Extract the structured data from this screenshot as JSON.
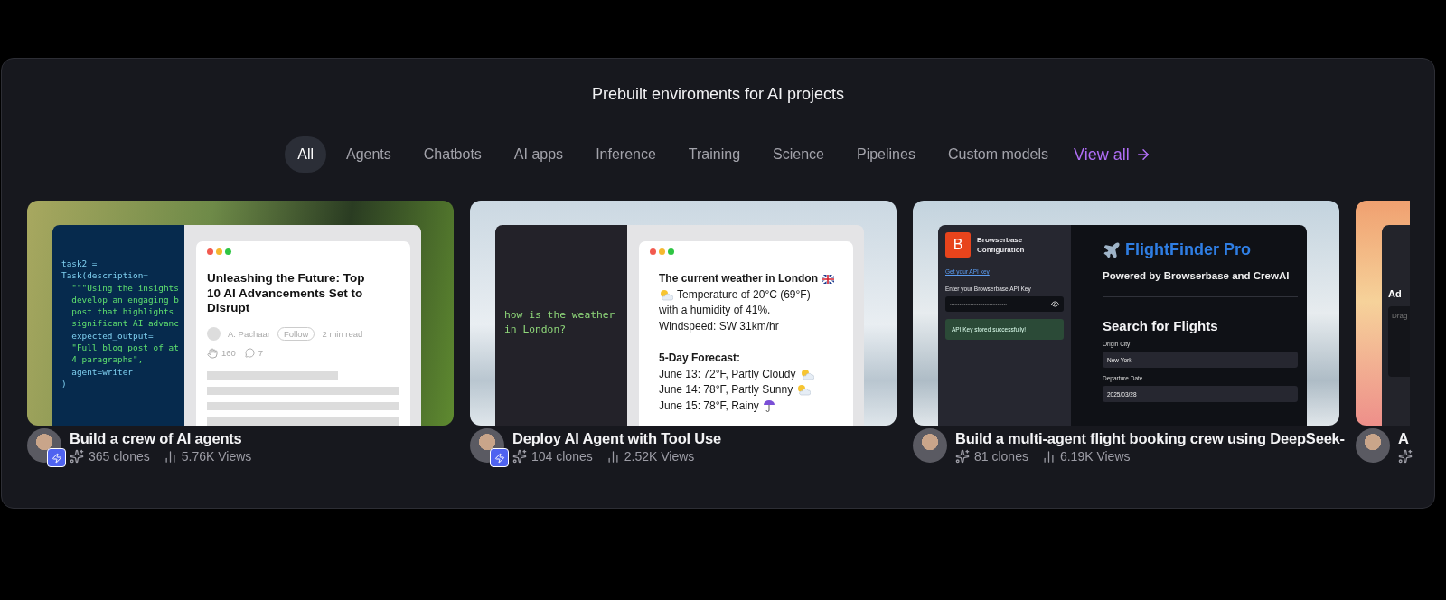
{
  "heading": "Prebuilt enviroments for AI projects",
  "tabs": [
    {
      "label": "All",
      "selected": true
    },
    {
      "label": "Agents",
      "selected": false
    },
    {
      "label": "Chatbots",
      "selected": false
    },
    {
      "label": "AI apps",
      "selected": false
    },
    {
      "label": "Inference",
      "selected": false
    },
    {
      "label": "Training",
      "selected": false
    },
    {
      "label": "Science",
      "selected": false
    },
    {
      "label": "Pipelines",
      "selected": false
    },
    {
      "label": "Custom models",
      "selected": false
    }
  ],
  "view_all": "View all",
  "templates": [
    {
      "preview": {
        "kind": "blog",
        "code": [
          {
            "text": "task2 =",
            "kind": "plain"
          },
          {
            "text": "Task(description=",
            "kind": "plain"
          },
          {
            "text": "  \"\"\"Using the insights",
            "kind": "string"
          },
          {
            "text": "  develop an engaging b",
            "kind": "string"
          },
          {
            "text": "  post that highlights",
            "kind": "string"
          },
          {
            "text": "  significant AI advanc",
            "kind": "string"
          },
          {
            "text": "  expected_output=",
            "kind": "plain"
          },
          {
            "text": "  \"Full blog post of at",
            "kind": "string"
          },
          {
            "text": "  4 paragraphs\",",
            "kind": "string"
          },
          {
            "text": "  agent=writer",
            "kind": "plain"
          },
          {
            "text": ")",
            "kind": "plain"
          }
        ],
        "article": {
          "title": "Unleashing the Future: Top 10 AI Advancements Set to Disrupt",
          "author": "A. Pachaar",
          "follow": "Follow",
          "read_time": "2 min read",
          "claps": "160",
          "comments": "7"
        }
      },
      "caption": {
        "title": "Build a crew of AI agents",
        "clones": "365 clones",
        "views": "5.76K Views",
        "badge": true
      }
    },
    {
      "preview": {
        "kind": "chat",
        "prompt": "how is the weather in London?",
        "reply": [
          {
            "text": "The current weather in London",
            "kind": "title"
          },
          {
            "text": "Temperature of 20°C (69°F)",
            "kind": "lead"
          },
          {
            "text": "with a humidity of 41%.",
            "kind": "plain"
          },
          {
            "text": "Windspeed: SW 31km/hr",
            "kind": "plain"
          },
          {
            "text": "5-Day Forecast:",
            "kind": "heading"
          },
          {
            "text": "June 13: 72°F, Partly Cloudy",
            "kind": "cloudy"
          },
          {
            "text": "June 14: 78°F, Partly Sunny",
            "kind": "sunny"
          },
          {
            "text": "June 15: 78°F, Rainy",
            "kind": "rainy"
          }
        ]
      },
      "caption": {
        "title": "Deploy AI Agent with Tool Use",
        "clones": "104 clones",
        "views": "2.52K Views",
        "badge": true
      }
    },
    {
      "preview": {
        "kind": "flight_app",
        "logo": "B",
        "sidebar_title": "Browserbase Configuration",
        "link": "Get your API key",
        "key_label": "Enter your Browserbase API Key",
        "key_value": "••••••••••••••••••••••••••••••••••••",
        "success": "API Key stored successfully!",
        "app_title": "FlightFinder Pro",
        "subtitle": "Powered by Browserbase and CrewAI",
        "section": "Search for Flights",
        "fields": [
          {
            "label": "Origin City",
            "value": "New York"
          },
          {
            "label": "Departure Date",
            "value": "2025/03/28"
          }
        ]
      },
      "caption": {
        "title": "Build a multi-agent flight booking crew using DeepSeek-",
        "clones": "81 clones",
        "views": "6.19K Views",
        "badge": false
      }
    },
    {
      "preview": {
        "kind": "partial",
        "heading": "Ad",
        "drop_hint": "Drag"
      },
      "caption": {
        "title": "A",
        "badge": false
      }
    }
  ]
}
